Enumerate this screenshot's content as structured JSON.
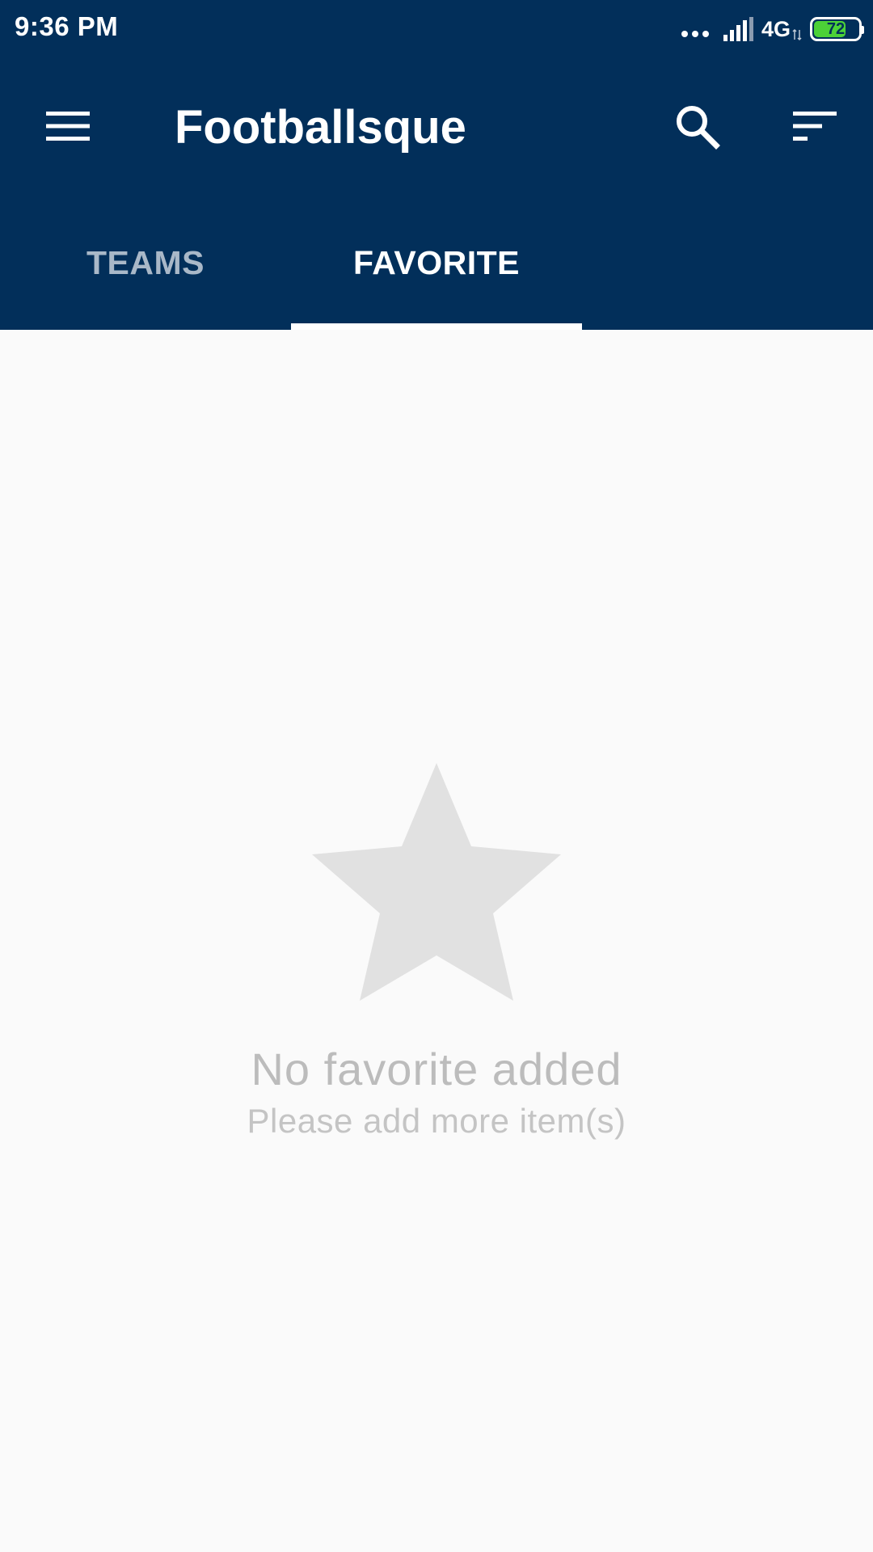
{
  "status_bar": {
    "time": "9:36 PM",
    "network": "4G",
    "battery_level": "72",
    "battery_fraction": 0.72,
    "battery_color": "#4cd137"
  },
  "toolbar": {
    "menu_icon": "hamburger-menu-icon",
    "title": "Footballsque",
    "search_icon": "search-icon",
    "sort_icon": "sort-icon",
    "background_color": "#022f5a"
  },
  "tabs": [
    {
      "label": "TEAMS",
      "selected": false
    },
    {
      "label": "FAVORITE",
      "selected": true
    }
  ],
  "empty_state": {
    "icon": "star-icon",
    "title": "No favorite added",
    "subtitle": "Please add more item(s)"
  }
}
